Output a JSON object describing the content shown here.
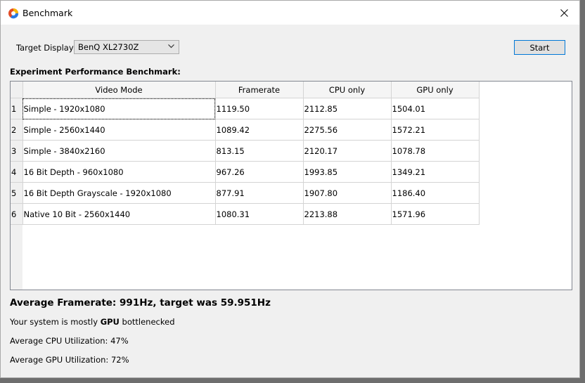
{
  "window": {
    "title": "Benchmark"
  },
  "controls": {
    "target_display_label": "Target Display:",
    "target_display_value": "BenQ XL2730Z",
    "start_label": "Start"
  },
  "section_title": "Experiment Performance Benchmark:",
  "table": {
    "columns": [
      "Video Mode",
      "Framerate",
      "CPU only",
      "GPU only"
    ],
    "rows": [
      {
        "num": "1",
        "mode": "Simple - 1920x1080",
        "framerate": "1119.50",
        "cpu": "2112.85",
        "gpu": "1504.01"
      },
      {
        "num": "2",
        "mode": "Simple - 2560x1440",
        "framerate": "1089.42",
        "cpu": "2275.56",
        "gpu": "1572.21"
      },
      {
        "num": "3",
        "mode": "Simple - 3840x2160",
        "framerate": "813.15",
        "cpu": "2120.17",
        "gpu": "1078.78"
      },
      {
        "num": "4",
        "mode": "16 Bit Depth - 960x1080",
        "framerate": "967.26",
        "cpu": "1993.85",
        "gpu": "1349.21"
      },
      {
        "num": "5",
        "mode": "16 Bit Depth Grayscale - 1920x1080",
        "framerate": "877.91",
        "cpu": "1907.80",
        "gpu": "1186.40"
      },
      {
        "num": "6",
        "mode": "Native 10 Bit - 2560x1440",
        "framerate": "1080.31",
        "cpu": "2213.88",
        "gpu": "1571.96"
      }
    ]
  },
  "summary": {
    "avg_framerate": "Average Framerate: 991Hz, target was 59.951Hz",
    "bottleneck_prefix": "Your system is mostly ",
    "bottleneck_strong": "GPU",
    "bottleneck_suffix": " bottlenecked",
    "cpu_util": "Average CPU Utilization: 47%",
    "gpu_util": "Average GPU Utilization: 72%"
  },
  "colors": {
    "accent": "#0078d7",
    "window_bg": "#f0f0f0",
    "grid_border": "#828790"
  },
  "icons": {
    "app": "app-logo-icon",
    "close": "close-icon",
    "dropdown": "chevron-down-icon"
  }
}
